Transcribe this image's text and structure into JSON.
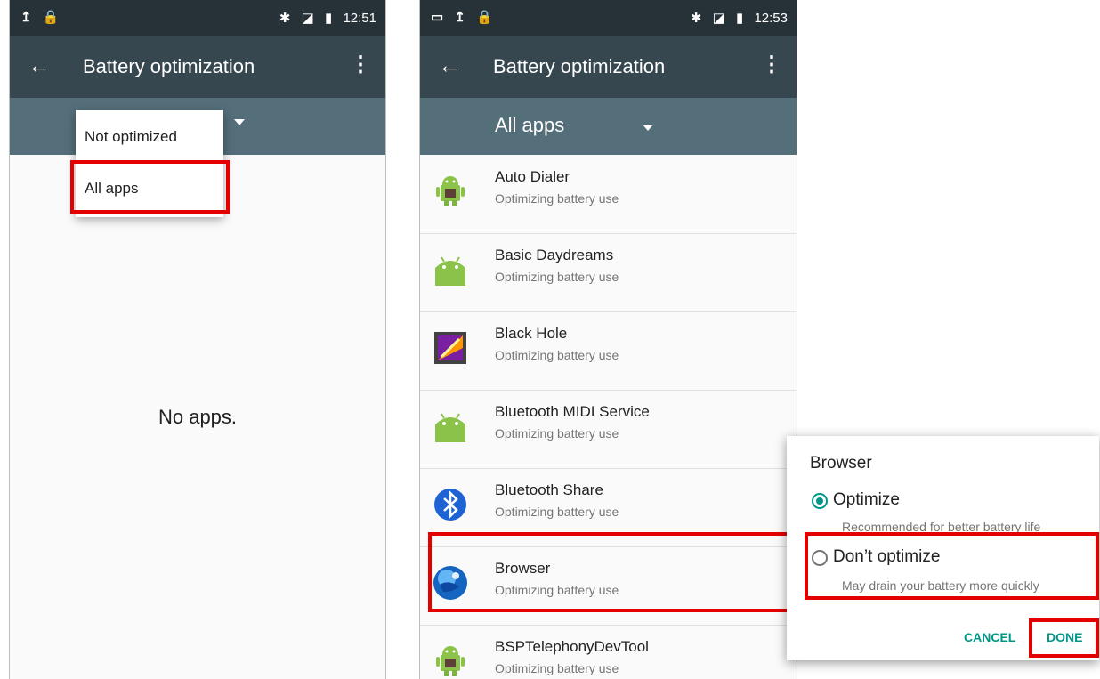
{
  "left_screen": {
    "status_time": "12:51",
    "app_title": "Battery optimization",
    "filter_menu": [
      "Not optimized",
      "All apps"
    ],
    "empty_text": "No apps."
  },
  "right_screen": {
    "status_time": "12:53",
    "app_title": "Battery optimization",
    "filter_label": "All apps",
    "apps": [
      {
        "name": "Auto Dialer",
        "status": "Optimizing battery use",
        "icon": "android-robot-icon"
      },
      {
        "name": "Basic Daydreams",
        "status": "Optimizing battery use",
        "icon": "android-head-icon"
      },
      {
        "name": "Black Hole",
        "status": "Optimizing battery use",
        "icon": "black-hole-icon"
      },
      {
        "name": "Bluetooth MIDI Service",
        "status": "Optimizing battery use",
        "icon": "android-head-icon"
      },
      {
        "name": "Bluetooth Share",
        "status": "Optimizing battery use",
        "icon": "bluetooth-icon"
      },
      {
        "name": "Browser",
        "status": "Optimizing battery use",
        "icon": "globe-icon"
      },
      {
        "name": "BSPTelephonyDevTool",
        "status": "Optimizing battery use",
        "icon": "android-robot-icon"
      }
    ]
  },
  "dialog": {
    "title": "Browser",
    "option_optimize": "Optimize",
    "option_optimize_desc": "Recommended for better battery life",
    "option_dont": "Don’t optimize",
    "option_dont_desc": "May drain your battery more quickly",
    "cancel_label": "CANCEL",
    "done_label": "DONE",
    "selected": "Optimize"
  },
  "colors": {
    "status_bar": "#263238",
    "app_bar": "#37474f",
    "filter_bar": "#546e7a",
    "accent": "#009688",
    "highlight": "#e50000"
  }
}
